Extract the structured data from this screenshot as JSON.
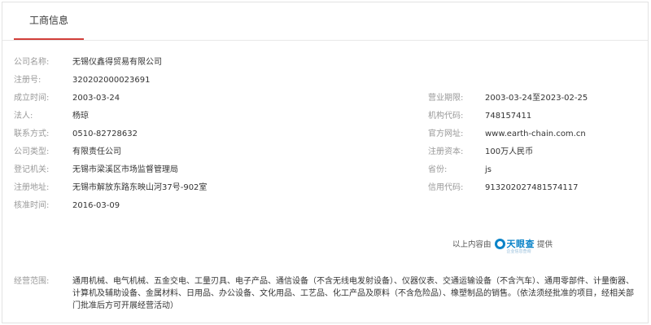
{
  "tab": {
    "label": "工商信息"
  },
  "fields_left": [
    {
      "label": "公司名称:",
      "value": "无锡仪鑫得贸易有限公司"
    },
    {
      "label": "注册号:",
      "value": "320202000023691"
    },
    {
      "label": "成立时间:",
      "value": "2003-03-24"
    },
    {
      "label": "法人:",
      "value": "杨琼"
    },
    {
      "label": "联系方式:",
      "value": "0510-82728632"
    },
    {
      "label": "公司类型:",
      "value": "有限责任公司"
    },
    {
      "label": "登记机关:",
      "value": "无锡市梁溪区市场监督管理局"
    },
    {
      "label": "注册地址:",
      "value": "无锡市解放东路东映山河37号-902室"
    },
    {
      "label": "核准时间:",
      "value": "2016-03-09"
    }
  ],
  "fields_right": [
    {
      "label": "营业期限:",
      "value": "2003-03-24至2023-02-25"
    },
    {
      "label": "机构代码:",
      "value": "748157411"
    },
    {
      "label": "官方网址:",
      "value": "www.earth-chain.com.cn"
    },
    {
      "label": "注册资本:",
      "value": "100万人民币"
    },
    {
      "label": "省份:",
      "value": "js"
    },
    {
      "label": "信用代码:",
      "value": "91320202748157411​7"
    }
  ],
  "provider": {
    "prefix": "以上内容由",
    "brand": "天眼查",
    "brand_sub": "企业信息查询",
    "suffix": "提供"
  },
  "scope": {
    "label": "经营范围:",
    "text": "通用机械、电气机械、五金交电、工量刃具、电子产品、通信设备（不含无线电发射设备）、仪器仪表、交通运输设备（不含汽车）、通用零部件、计量衡器、计算机及辅助设备、金属材料、日用品、办公设备、文化用品、工艺品、化工产品及原料（不含危险品）、橡塑制品的销售。（依法须经批准的项目，经相关部门批准后方可开展经营活动）"
  }
}
